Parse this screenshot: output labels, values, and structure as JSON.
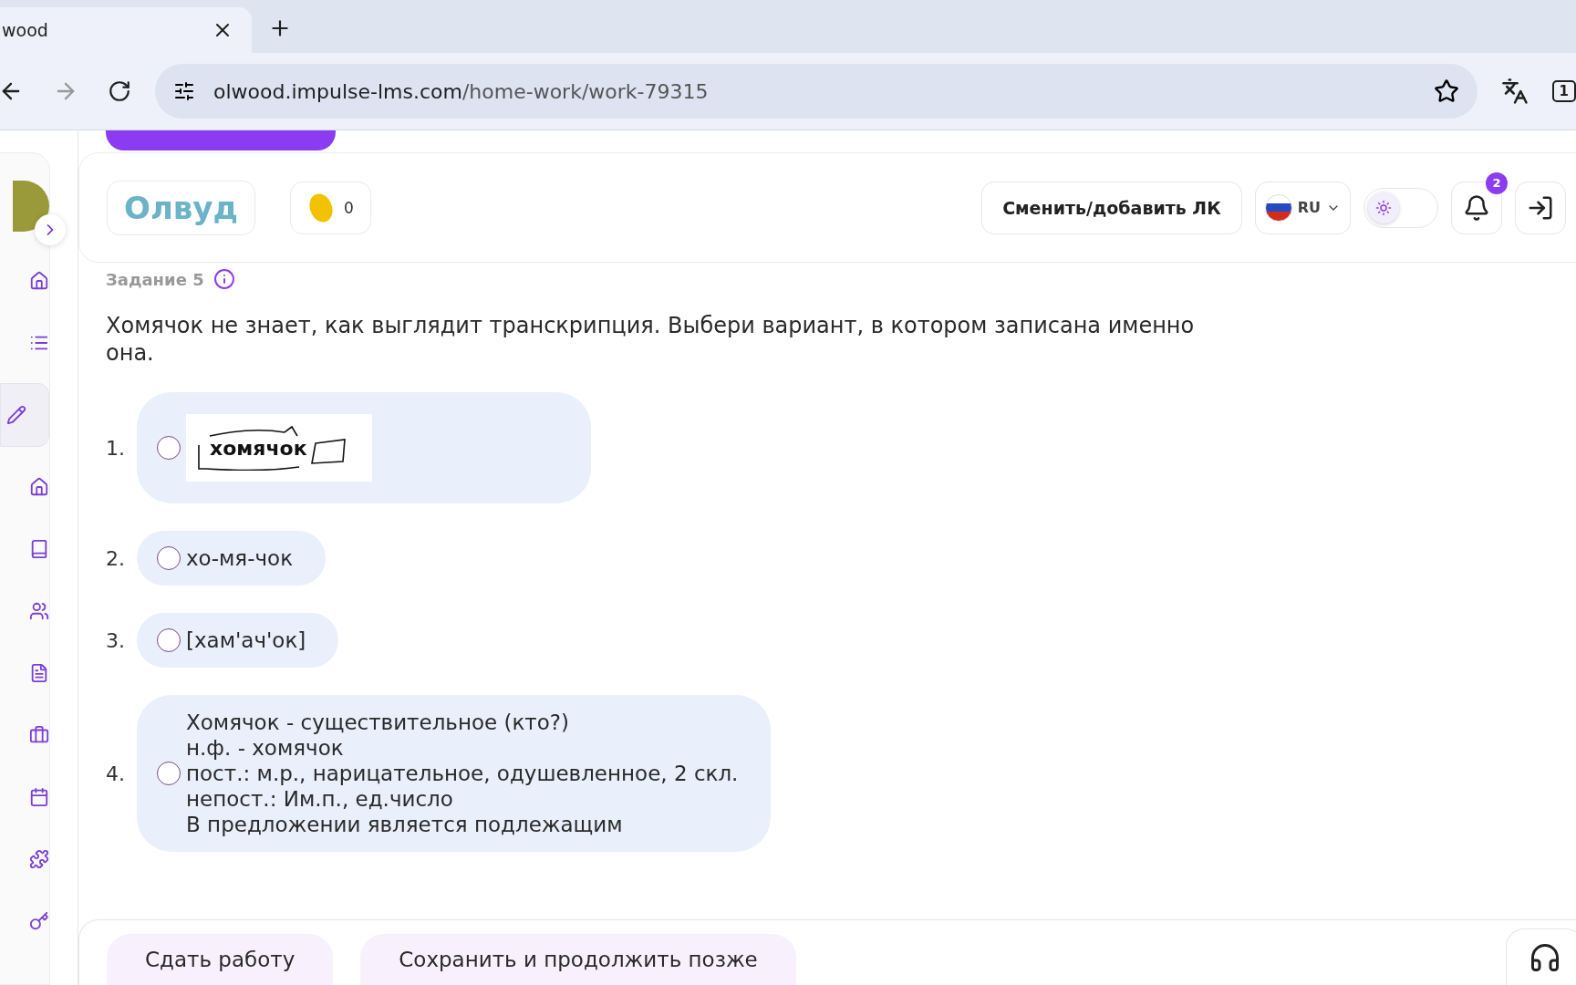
{
  "browser": {
    "tab_title": "wood",
    "url_domain": "olwood.impulse-lms.com",
    "url_path": "/home-work/work-79315",
    "tab_count": "1"
  },
  "sidebar": {
    "items": [
      {
        "selected": false
      },
      {
        "selected": false
      },
      {
        "selected": true
      },
      {
        "selected": false
      },
      {
        "selected": false
      },
      {
        "selected": false
      },
      {
        "selected": false
      },
      {
        "selected": false
      },
      {
        "selected": false
      },
      {
        "selected": false
      },
      {
        "selected": false
      }
    ]
  },
  "header": {
    "logo": "Олвуд",
    "coins": "0",
    "switch_account": "Сменить/добавить ЛК",
    "language": "RU",
    "dark_mode": false,
    "notifications": "2"
  },
  "task": {
    "label": "Задание 5",
    "question": "Хомячок не знает, как выглядит транскрипция. Выбери вариант, в котором записана именно она.",
    "options": [
      {
        "number": "1.",
        "kind": "image",
        "image_word": "хомячок",
        "selected": false
      },
      {
        "number": "2.",
        "kind": "text",
        "lines": [
          "хо-мя-чок"
        ],
        "selected": false
      },
      {
        "number": "3.",
        "kind": "text",
        "lines": [
          "[хам'ач'ок]"
        ],
        "selected": false
      },
      {
        "number": "4.",
        "kind": "text",
        "lines": [
          "Хомячок - существительное (кто?)",
          "н.ф. - хомячок",
          "пост.: м.р., нарицательное, одушевленное, 2 скл.",
          "непост.: Им.п., ед.число",
          "В предложении является подлежащим"
        ],
        "selected": false
      }
    ]
  },
  "footer": {
    "buttons": [
      "Сдать работу",
      "Сохранить и продолжить позже"
    ]
  }
}
